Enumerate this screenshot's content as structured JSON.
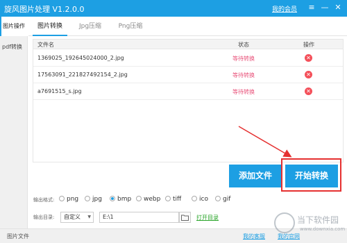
{
  "app": {
    "title": "旋风图片处理 V1.2.0.0",
    "member_link": "我的会员",
    "controls": {
      "menu": "≡",
      "minimize": "—",
      "close": "✕"
    }
  },
  "sidebar": {
    "items": [
      {
        "label": "图片操作",
        "active": true
      },
      {
        "label": "pdf转换",
        "active": false
      }
    ]
  },
  "tabs": [
    {
      "label": "图片转换",
      "active": true
    },
    {
      "label": "Jpg压缩",
      "active": false
    },
    {
      "label": "Png压缩",
      "active": false
    }
  ],
  "table": {
    "headers": {
      "name": "文件名",
      "status": "状态",
      "action": "操作"
    },
    "rows": [
      {
        "name": "1369025_192645024000_2.jpg",
        "status": "等待转换"
      },
      {
        "name": "17563091_221827492154_2.jpg",
        "status": "等待转换"
      },
      {
        "name": "a7691515_s.jpg",
        "status": "等待转换"
      }
    ],
    "delete_icon": "✕"
  },
  "buttons": {
    "add_file": "添加文件",
    "start": "开始转换"
  },
  "format": {
    "label": "输出格式:",
    "options": [
      "png",
      "jpg",
      "bmp",
      "webp",
      "tiff",
      "ico",
      "gif"
    ],
    "selected": "bmp"
  },
  "output": {
    "label": "输出目录:",
    "select_value": "自定义",
    "path": "E:\\1",
    "open_link": "打开目录",
    "folder_icon": "▭"
  },
  "statusbar": {
    "left": "图片文件",
    "guest": "我的客服",
    "site": "我的官网"
  },
  "watermark": {
    "line1": "当下软件园",
    "line2": "www.downxia.com"
  },
  "colors": {
    "accent": "#1d9fe3",
    "status": "#e8527a",
    "delete": "#f4505a",
    "highlight": "#e53030",
    "arrow": "#e53030",
    "link_green": "#2aa52a"
  }
}
